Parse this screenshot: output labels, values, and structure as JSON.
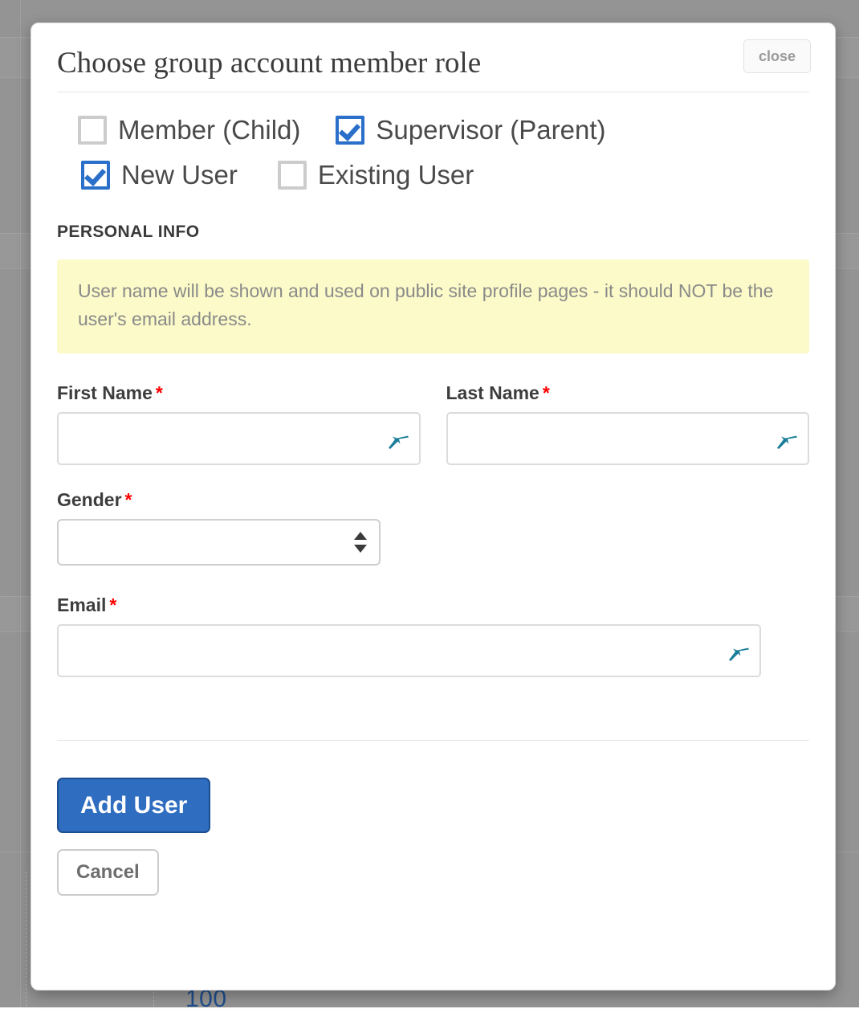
{
  "background": {
    "partial_number_label": "100"
  },
  "modal": {
    "title": "Choose group account member role",
    "close_label": "close",
    "role_options": [
      {
        "label": "Member (Child)",
        "checked": false,
        "name": "member-child"
      },
      {
        "label": "Supervisor (Parent)",
        "checked": true,
        "name": "supervisor-parent"
      }
    ],
    "user_type_options": [
      {
        "label": "New User",
        "checked": true,
        "name": "new-user"
      },
      {
        "label": "Existing User",
        "checked": false,
        "name": "existing-user"
      }
    ],
    "section_heading": "PERSONAL INFO",
    "info_banner": "User name will be shown and used on public site profile pages - it should NOT be the user's email address.",
    "fields": {
      "first_name": {
        "label": "First Name",
        "required_marker": "*",
        "value": "",
        "placeholder": ""
      },
      "last_name": {
        "label": "Last Name",
        "required_marker": "*",
        "value": "",
        "placeholder": ""
      },
      "gender": {
        "label": "Gender",
        "required_marker": "*",
        "selected": "",
        "options": [
          ""
        ]
      },
      "email": {
        "label": "Email",
        "required_marker": "*",
        "value": "",
        "placeholder": ""
      }
    },
    "actions": {
      "submit_label": "Add User",
      "cancel_label": "Cancel"
    },
    "icons": {
      "input_autofill": "key-icon",
      "select_stepper": "stepper-arrows-icon"
    },
    "colors": {
      "accent_blue": "#2e6dc0",
      "checkbox_blue": "#2a6fc9",
      "required_red": "#ff0000",
      "banner_yellow": "#fbfac8",
      "autofill_teal": "#1b7f99",
      "backdrop_gray": "#949494"
    }
  }
}
